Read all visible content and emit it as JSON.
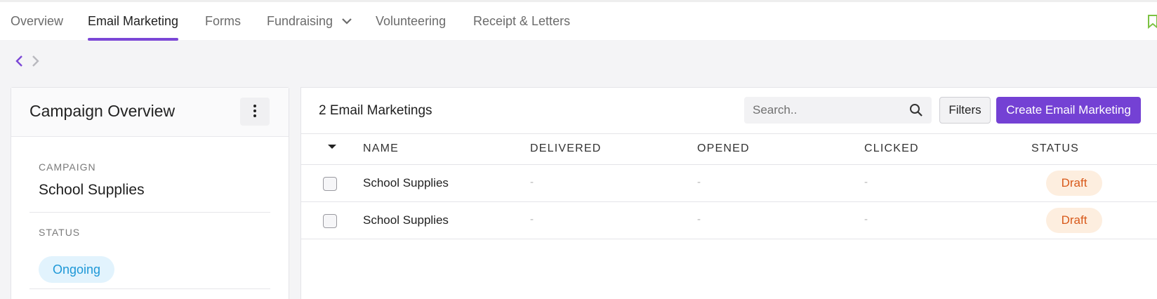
{
  "nav": {
    "tabs": [
      {
        "label": "Overview"
      },
      {
        "label": "Email Marketing",
        "active": true
      },
      {
        "label": "Forms"
      },
      {
        "label": "Fundraising",
        "has_dropdown": true
      },
      {
        "label": "Volunteering"
      },
      {
        "label": "Receipt & Letters"
      }
    ],
    "accent_color": "#7b47d6"
  },
  "pager": {
    "prev_icon": "chevron-left-icon",
    "next_icon": "chevron-right-icon"
  },
  "overview": {
    "title": "Campaign Overview",
    "menu_icon": "kebab-menu-icon",
    "campaign_label": "CAMPAIGN",
    "campaign_value": "School Supplies",
    "status_label": "STATUS",
    "status_value": "Ongoing",
    "status_color": "#1e98d7"
  },
  "list": {
    "count_title": "2 Email Marketings",
    "search_placeholder": "Search..",
    "filters_label": "Filters",
    "create_label": "Create Email Marketing",
    "create_color": "#7441d4",
    "columns": [
      "NAME",
      "DELIVERED",
      "OPENED",
      "CLICKED",
      "STATUS"
    ],
    "rows": [
      {
        "name": "School Supplies",
        "delivered": "-",
        "opened": "-",
        "clicked": "-",
        "status": "Draft"
      },
      {
        "name": "School Supplies",
        "delivered": "-",
        "opened": "-",
        "clicked": "-",
        "status": "Draft"
      }
    ],
    "draft_color": "#d8591a"
  }
}
